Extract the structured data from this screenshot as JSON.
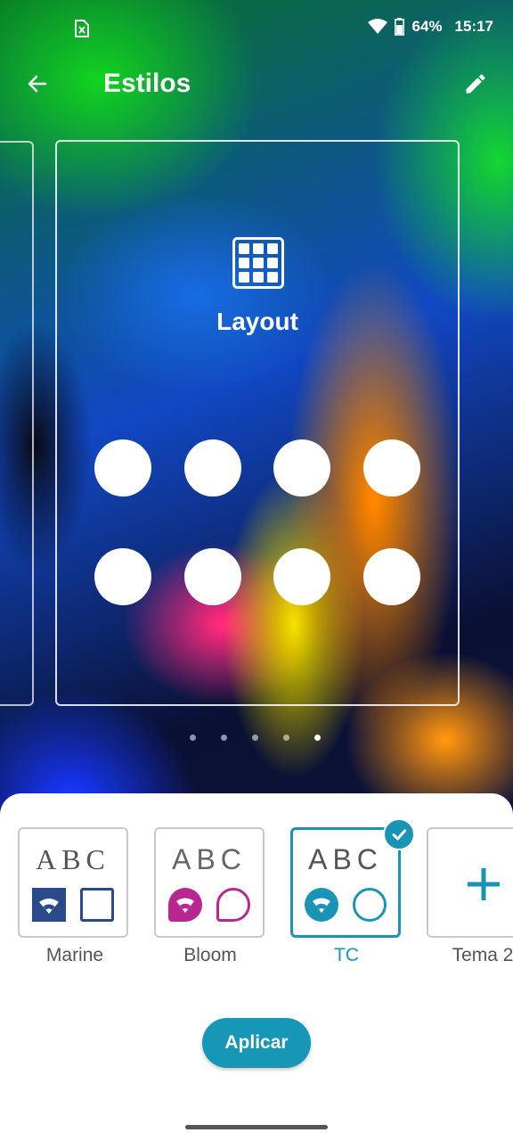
{
  "status_bar": {
    "battery": "64%",
    "time": "15:17"
  },
  "app_bar": {
    "title": "Estilos"
  },
  "preview": {
    "label": "Layout",
    "page_count": 5,
    "active_page": 5
  },
  "themes": [
    {
      "name": "Marine",
      "abc": "ABC",
      "color": "#2a4a8a",
      "selected": false
    },
    {
      "name": "Bloom",
      "abc": "ABC",
      "color": "#b8278f",
      "selected": false
    },
    {
      "name": "TC",
      "abc": "ABC",
      "color": "#1a94b6",
      "selected": true
    },
    {
      "name": "Tema 2",
      "icon": "plus-icon",
      "color": "#1a94b6",
      "selected": false
    }
  ],
  "apply_button": {
    "label": "Aplicar"
  },
  "colors": {
    "accent": "#1a94b6",
    "sheet": "#ffffff"
  }
}
